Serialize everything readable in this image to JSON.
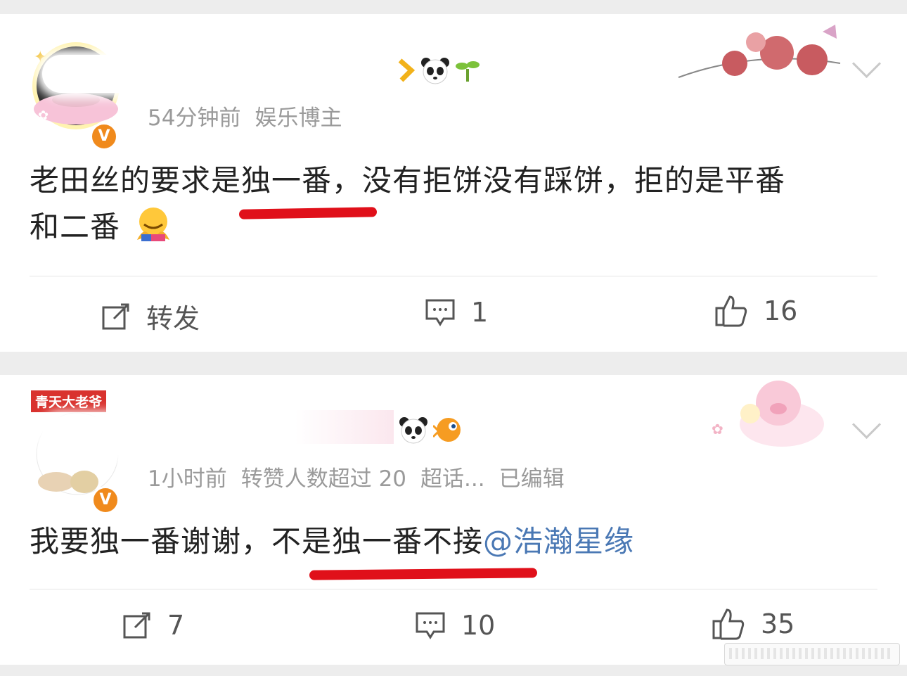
{
  "posts": [
    {
      "time": "54分钟前",
      "tags": [
        "娱乐博主"
      ],
      "text_parts": [
        "老田丝的要求是独一番，没有拒饼没有踩饼，拒的是平番",
        "和二番"
      ],
      "reactions": {
        "repost_label": "转发",
        "comment_count": "1",
        "like_count": "16"
      }
    },
    {
      "avatar_badge": "青天大老爷",
      "time": "1小时前",
      "tags": [
        "转赞人数超过 20",
        "超话...",
        "已编辑"
      ],
      "text_plain": "我要独一番谢谢，不是独一番不接",
      "mention": "@浩瀚星缘",
      "reactions": {
        "repost_count": "7",
        "comment_count": "10",
        "like_count": "35"
      }
    }
  ],
  "colors": {
    "accent_red_underline": "#e0101a",
    "mention_blue": "#4a78b4",
    "verified_orange": "#f08a1c"
  },
  "icons": [
    "verified-badge-icon",
    "panda-icon",
    "sprout-icon",
    "pufferfish-icon",
    "chevron-down-icon",
    "repost-icon",
    "comment-icon",
    "like-icon"
  ]
}
